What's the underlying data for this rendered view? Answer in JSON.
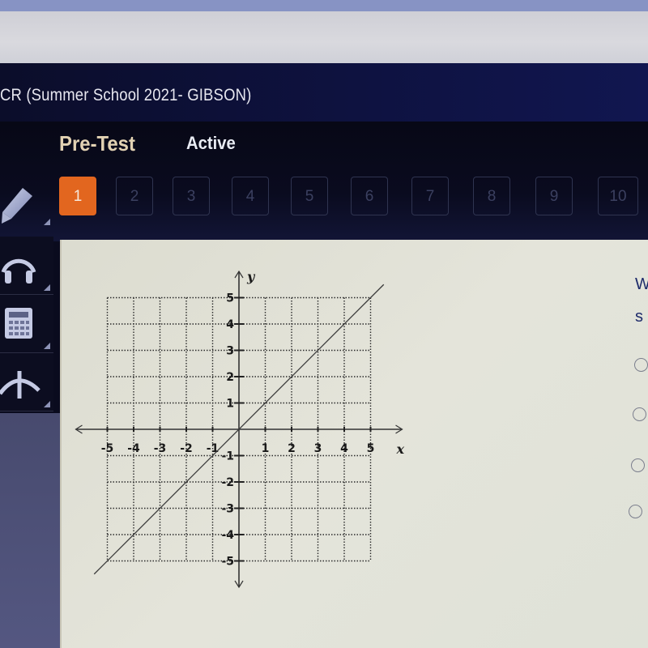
{
  "course": {
    "title": "CR (Summer School 2021- GIBSON)"
  },
  "assessment": {
    "name": "Pre-Test",
    "status": "Active",
    "current_question": 1,
    "questions": [
      "1",
      "2",
      "3",
      "4",
      "5",
      "6",
      "7",
      "8",
      "9",
      "10"
    ]
  },
  "toolbar": {
    "tools": [
      {
        "name": "pencil-icon",
        "label": "Pencil"
      },
      {
        "name": "headphones-icon",
        "label": "Text to speech"
      },
      {
        "name": "calculator-icon",
        "label": "Calculator"
      },
      {
        "name": "reference-icon",
        "label": "Reference"
      }
    ]
  },
  "question": {
    "line1": "W",
    "line2": "s",
    "options": [
      "",
      "",
      "",
      ""
    ]
  },
  "chart_data": {
    "type": "line",
    "title": "",
    "xlabel": "x",
    "ylabel": "y",
    "xlim": [
      -5,
      5
    ],
    "ylim": [
      -5,
      5
    ],
    "grid": true,
    "x_ticks": [
      "-5",
      "-4",
      "-3",
      "-2",
      "-1",
      "1",
      "2",
      "3",
      "4",
      "5"
    ],
    "y_ticks": [
      "5",
      "4",
      "3",
      "2",
      "1",
      "-1",
      "-2",
      "-3",
      "-4",
      "-5"
    ],
    "series": [
      {
        "name": "y = x",
        "equation": "y = x",
        "x": [
          -5.5,
          5.5
        ],
        "y": [
          -5.5,
          5.5
        ]
      }
    ]
  }
}
